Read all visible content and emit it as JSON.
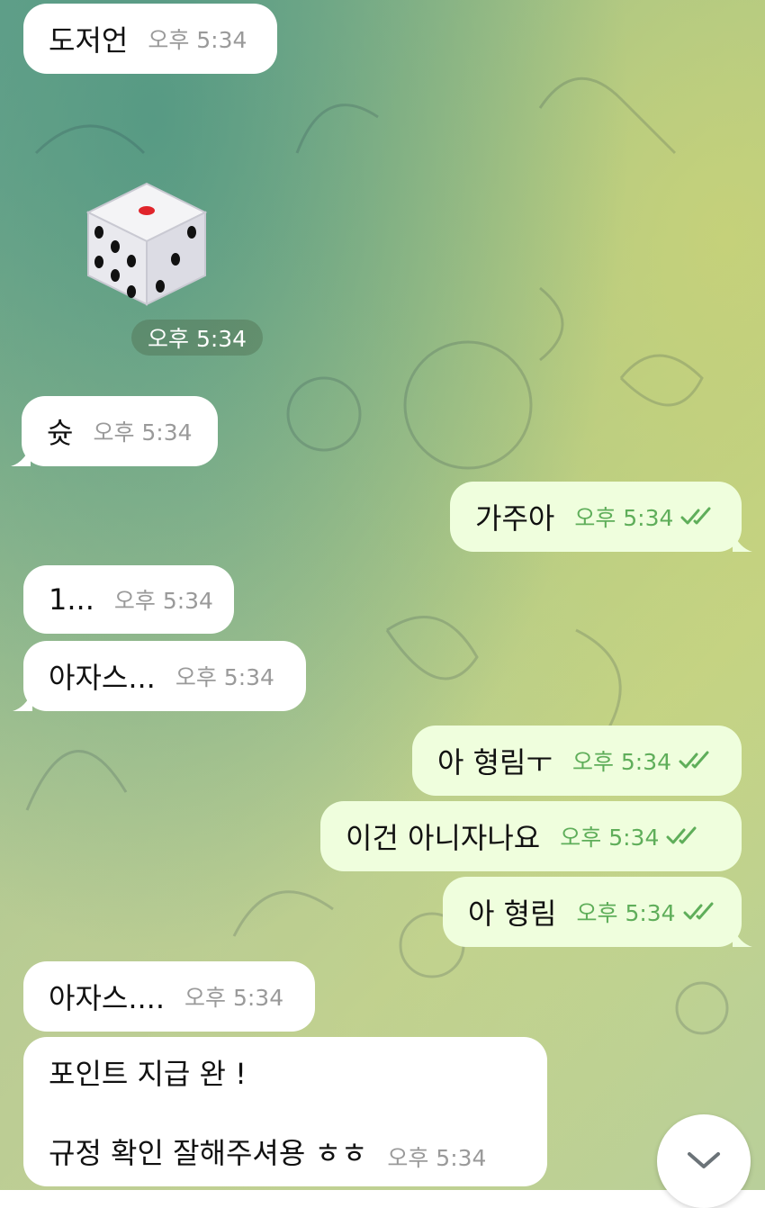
{
  "messages": [
    {
      "text": "도저언",
      "time": "오후 5:34"
    },
    {
      "time": "오후 5:34"
    },
    {
      "text": "슛",
      "time": "오후 5:34"
    },
    {
      "text": "가주아",
      "time": "오후 5:34"
    },
    {
      "text": "1...",
      "time": "오후 5:34"
    },
    {
      "text": "아자스...",
      "time": "오후 5:34"
    },
    {
      "text": "아 형림ㅜ",
      "time": "오후 5:34"
    },
    {
      "text": "이건 아니자나요",
      "time": "오후 5:34"
    },
    {
      "text": "아 형림",
      "time": "오후 5:34"
    },
    {
      "text": "아자스....",
      "time": "오후 5:34"
    },
    {
      "line1": "포인트 지급 완 !",
      "line2": "규정 확인 잘해주셔용 ㅎㅎ",
      "time": "오후 5:34"
    }
  ],
  "colors": {
    "incoming_bubble": "#ffffff",
    "outgoing_bubble": "#effedd",
    "read_check": "#5fae5a",
    "dice_pip": "#111111",
    "dice_center_pip": "#e0242b"
  },
  "icons": {
    "read": "double-check-icon",
    "dice": "dice-emoji",
    "scroll": "chevron-down-icon"
  }
}
